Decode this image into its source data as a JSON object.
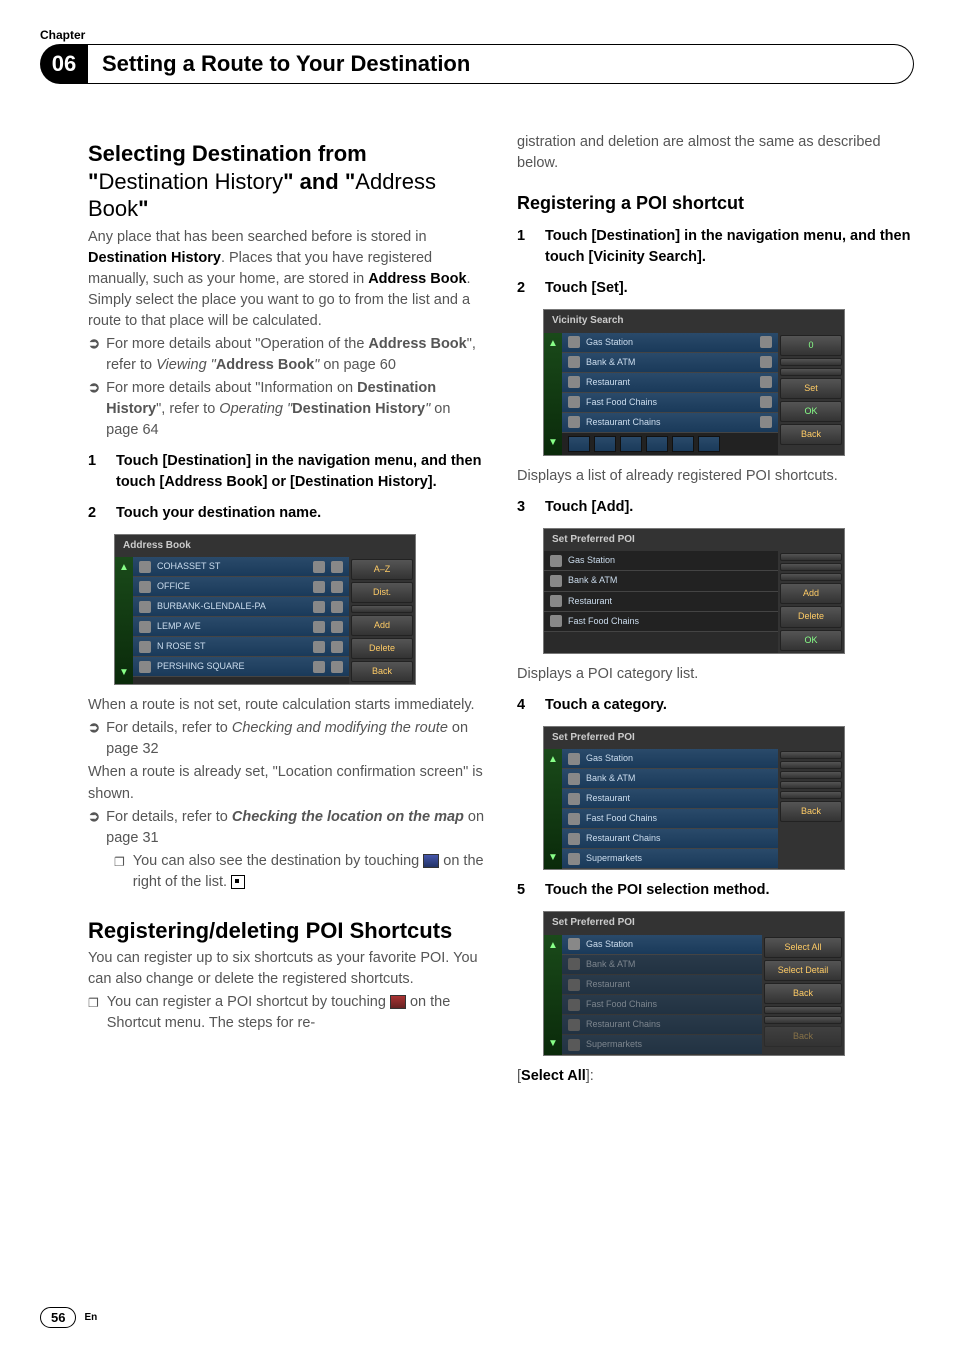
{
  "chapter": {
    "label": "Chapter",
    "number": "06",
    "title": "Setting a Route to Your Destination"
  },
  "page": {
    "number": "56",
    "lang": "En"
  },
  "left": {
    "h2a_pre": "Selecting Destination from \"",
    "h2a_mid1": "Destination History",
    "h2a_mid2": "\" and \"",
    "h2a_mid3": "Address Book",
    "h2a_post": "\"",
    "p1a": "Any place that has been searched before is stored in ",
    "p1b": "Destination History",
    "p1c": ". Places that you have registered manually, such as your home, are stored in ",
    "p1d": "Address Book",
    "p1e": ". Simply select the place you want to go to from the list and a route to that place will be calculated.",
    "b1a": "For more details about \"Operation of the ",
    "b1b": "Address Book",
    "b1c": "\", refer to ",
    "b1d": "Viewing \"",
    "b1e": "Address Book",
    "b1f": "\"",
    "b1g": " on page 60",
    "b2a": "For more details about \"Information on ",
    "b2b": "Destination History",
    "b2c": "\", refer to ",
    "b2d": "Operating \"",
    "b2e": "Destination History",
    "b2f": "\"",
    "b2g": " on page 64",
    "step1": "Touch [Destination] in the navigation menu, and then touch [Address Book] or [Destination History].",
    "step2": "Touch your destination name.",
    "shot1": {
      "title": "Address Book",
      "rows": [
        "COHASSET ST",
        "OFFICE",
        "BURBANK-GLENDALE-PA",
        "LEMP AVE",
        "N ROSE ST",
        "PERSHING SQUARE"
      ],
      "side": [
        "A–Z",
        "Dist.",
        "",
        "Add",
        "Delete",
        "Back"
      ]
    },
    "after1": "When a route is not set, route calculation starts immediately.",
    "b3a": "For details, refer to ",
    "b3b": "Checking and modifying the route",
    "b3c": " on page 32",
    "after2": "When a route is already set, \"Location confirmation screen\" is shown.",
    "b4a": "For details, refer to ",
    "b4b": "Checking the location on the map",
    "b4c": " on page 31",
    "note1a": "You can also see the destination by touching ",
    "note1b": " on the right of the list.",
    "h2b": "Registering/deleting POI Shortcuts",
    "p2": "You can register up to six shortcuts as your favorite POI. You can also change or delete the registered shortcuts.",
    "note2a": "You can register a POI shortcut by touching ",
    "note2b": " on the Shortcut menu. The steps for re-"
  },
  "right": {
    "cont": "gistration and deletion are almost the same as described below.",
    "h3a": "Registering a POI shortcut",
    "step1": "Touch [Destination] in the navigation menu, and then touch [Vicinity Search].",
    "step2": "Touch [Set].",
    "shot2": {
      "title": "Vicinity Search",
      "rows": [
        "Gas Station",
        "Bank & ATM",
        "Restaurant",
        "Fast Food Chains",
        "Restaurant Chains"
      ],
      "side": [
        "0",
        "",
        "",
        "Set",
        "OK",
        "Back"
      ]
    },
    "cap2": "Displays a list of already registered POI shortcuts.",
    "step3": "Touch [Add].",
    "shot3": {
      "title": "Set Preferred POI",
      "rows": [
        "Gas Station",
        "Bank & ATM",
        "Restaurant",
        "Fast Food Chains"
      ],
      "side": [
        "",
        "",
        "",
        "Add",
        "Delete",
        "OK"
      ]
    },
    "cap3": "Displays a POI category list.",
    "step4": "Touch a category.",
    "shot4": {
      "title": "Set Preferred POI",
      "rows": [
        "Gas Station",
        "Bank & ATM",
        "Restaurant",
        "Fast Food Chains",
        "Restaurant Chains",
        "Supermarkets"
      ],
      "side": [
        "",
        "",
        "",
        "",
        "",
        "Back"
      ]
    },
    "step5": "Touch the POI selection method.",
    "shot5": {
      "title": "Set Preferred POI",
      "rows": [
        "Gas Station",
        "Bank & ATM",
        "Restaurant",
        "Fast Food Chains",
        "Restaurant Chains",
        "Supermarkets"
      ],
      "side": [
        "Select All",
        "Select Detail",
        "Back",
        "",
        "",
        "Back"
      ]
    },
    "last": "[",
    "lastb": "Select All",
    "lastc": "]:"
  }
}
